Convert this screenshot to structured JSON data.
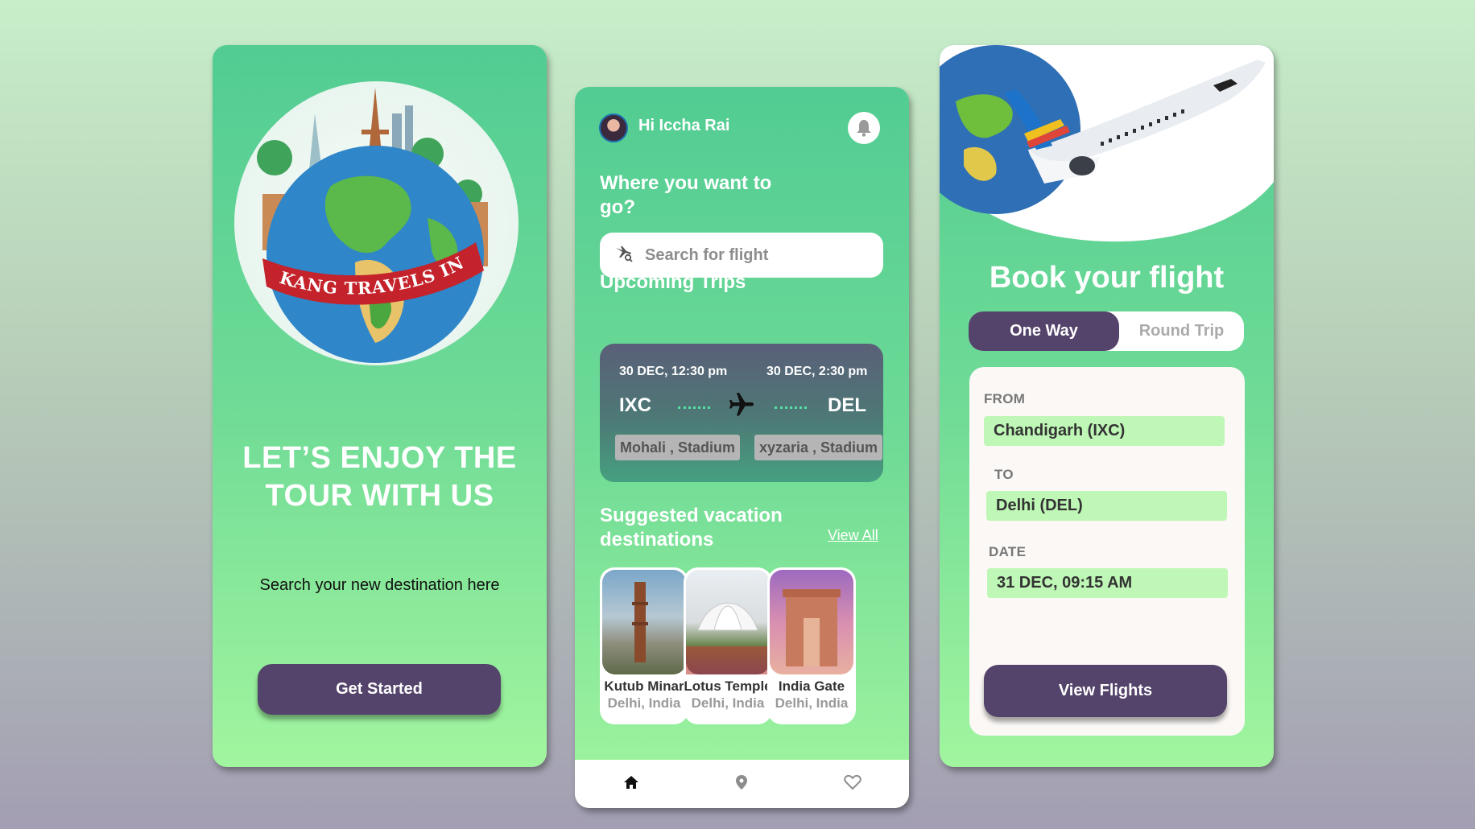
{
  "screen1": {
    "banner": "KANG TRAVELS INDIA",
    "title_line1": "LET’S ENJOY THE",
    "title_line2": "TOUR WITH US",
    "subtitle": "Search your new destination here",
    "button": "Get Started"
  },
  "screen2": {
    "greeting": "Hi Iccha Rai",
    "where_line1": "Where you want to",
    "where_line2": "go?",
    "search_placeholder": "Search for flight",
    "upcoming_title": "Upcoming Trips",
    "trip": {
      "depart_time": "30 DEC, 12:30 pm",
      "arrive_time": "30 DEC, 2:30 pm",
      "from_code": "IXC",
      "to_code": "DEL",
      "from_loc": "Mohali , Stadium",
      "to_loc": "xyzaria , Stadium"
    },
    "suggested_line1": "Suggested vacation",
    "suggested_line2": "destinations",
    "view_all": "View All",
    "destinations": [
      {
        "name": "Kutub Minar",
        "city": "Delhi, India"
      },
      {
        "name": "Lotus Temple",
        "city": "Delhi, India"
      },
      {
        "name": "India Gate",
        "city": "Delhi, India"
      }
    ],
    "nav": [
      "home-icon",
      "location-pin-icon",
      "heart-icon"
    ]
  },
  "screen3": {
    "title": "Book your flight",
    "tab_one_way": "One Way",
    "tab_round_trip": "Round Trip",
    "from_label": "FROM",
    "from_value": "Chandigarh (IXC)",
    "to_label": "TO",
    "to_value": "Delhi (DEL)",
    "date_label": "DATE",
    "date_value": "31 DEC, 09:15 AM",
    "button": "View Flights"
  },
  "colors": {
    "accent_dark": "#54436a",
    "screen_gradient_top": "#52cc93",
    "screen_gradient_bottom": "#a2f59f",
    "field_bg": "#bff7b6"
  }
}
